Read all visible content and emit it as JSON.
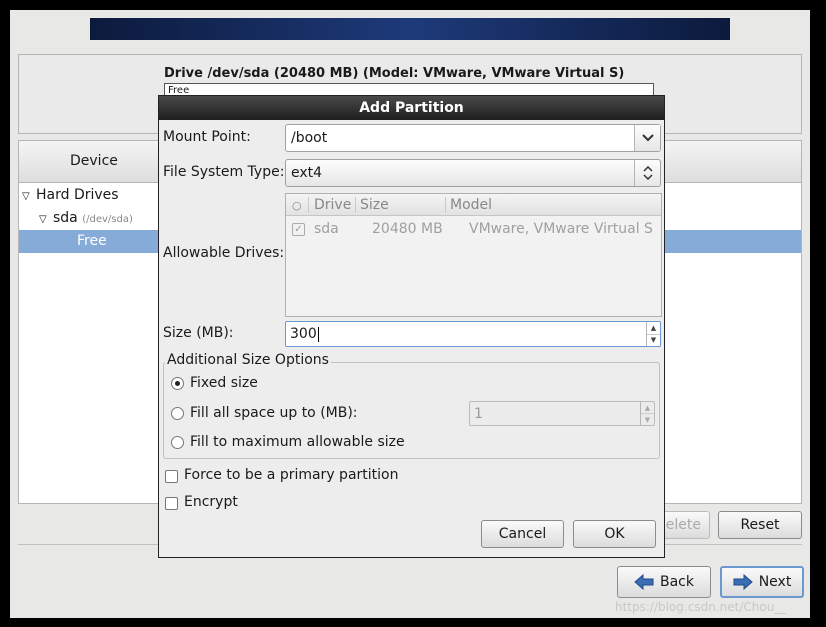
{
  "drive": {
    "label": "Drive /dev/sda (20480 MB) (Model: VMware, VMware Virtual S)",
    "bar_text": "Free"
  },
  "device_tree": {
    "column_header": "Device",
    "rows": [
      {
        "label": "Hard Drives",
        "sub": ""
      },
      {
        "label": "sda",
        "sub": "(/dev/sda)"
      },
      {
        "label": "Free",
        "sub": ""
      }
    ]
  },
  "actions": {
    "delete_label": "Delete",
    "reset_label": "Reset"
  },
  "nav": {
    "back_label": "Back",
    "next_label": "Next"
  },
  "watermark": "https://blog.csdn.net/Chou__",
  "dialog": {
    "title": "Add Partition",
    "mount_point_label": "Mount Point:",
    "mount_point_value": "/boot",
    "fs_type_label": "File System Type:",
    "fs_type_value": "ext4",
    "allowable_drives_label": "Allowable Drives:",
    "drives_table": {
      "columns": [
        "Drive",
        "Size",
        "Model"
      ],
      "rows": [
        {
          "drive": "sda",
          "size": "20480 MB",
          "model": "VMware, VMware Virtual S",
          "checked": true
        }
      ]
    },
    "size_label": "Size (MB):",
    "size_value": "300",
    "additional_options_title": "Additional Size Options",
    "options": [
      {
        "label": "Fixed size",
        "selected": true
      },
      {
        "label": "Fill all space up to (MB):",
        "selected": false
      },
      {
        "label": "Fill to maximum allowable size",
        "selected": false
      }
    ],
    "fill_up_to_value": "1",
    "force_primary_label": "Force to be a primary partition",
    "encrypt_label": "Encrypt",
    "cancel_label": "Cancel",
    "ok_label": "OK"
  }
}
